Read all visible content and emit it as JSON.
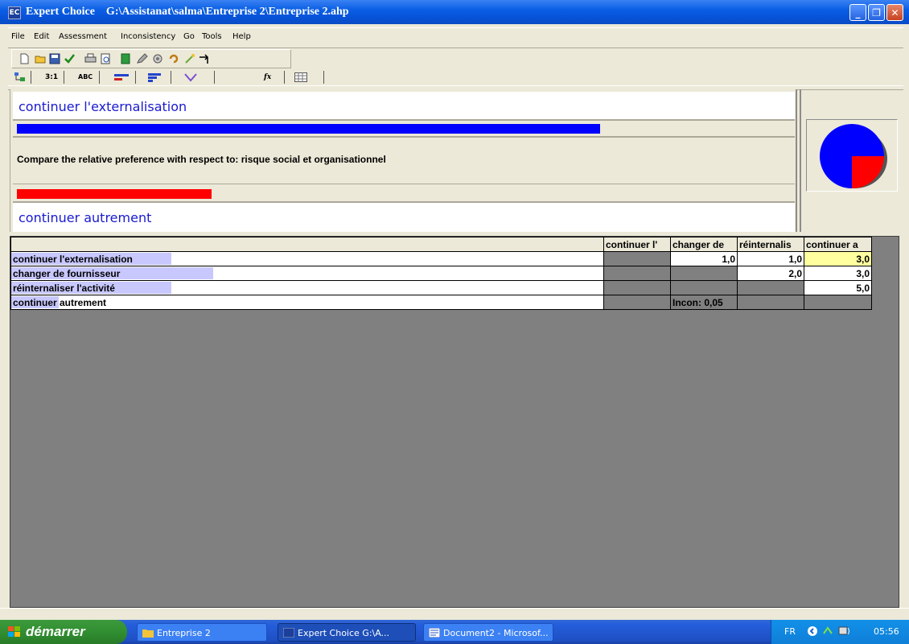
{
  "window": {
    "app_icon_label": "EC",
    "title": "Expert Choice    G:\\Assistanat\\salma\\Entreprise 2\\Entreprise 2.ahp",
    "min_symbol": "_",
    "restore_symbol": "❐",
    "close_symbol": "✕"
  },
  "menu": [
    "File",
    "Edit",
    "Assessment",
    "Inconsistency",
    "Go",
    "Tools",
    "Help"
  ],
  "tabs": [
    "3:1",
    "ABC",
    "fx"
  ],
  "comparison": {
    "top_alternative": "continuer l'externalisation",
    "prompt": "Compare the relative preference with respect to: risque social et organisationnel",
    "bottom_alternative": "continuer autrement",
    "top_bar_fraction": 0.75,
    "bottom_bar_fraction": 0.25,
    "top_color": "#0000ff",
    "bottom_color": "#ff0000"
  },
  "matrix": {
    "columns": [
      "continuer l'",
      "changer de",
      "réinternalis",
      "continuer a"
    ],
    "rows": [
      {
        "label": "continuer l'externalisation",
        "bar": 0.27,
        "cells": [
          "",
          "1,0",
          "1,0",
          "3,0"
        ]
      },
      {
        "label": "changer de fournisseur",
        "bar": 0.34,
        "cells": [
          "",
          "",
          "2,0",
          "3,0"
        ]
      },
      {
        "label": "réinternaliser l'activité",
        "bar": 0.27,
        "cells": [
          "",
          "",
          "",
          "5,0"
        ]
      },
      {
        "label": "continuer autrement",
        "bar": 0.08,
        "cells": [
          "",
          "Incon: 0,05",
          "",
          ""
        ]
      }
    ]
  },
  "taskbar": {
    "start_label": "démarrer",
    "tasks": [
      "Entreprise 2",
      "Expert Choice    G:\\A...",
      "Document2 - Microsof..."
    ],
    "language": "FR",
    "clock": "05:56"
  }
}
